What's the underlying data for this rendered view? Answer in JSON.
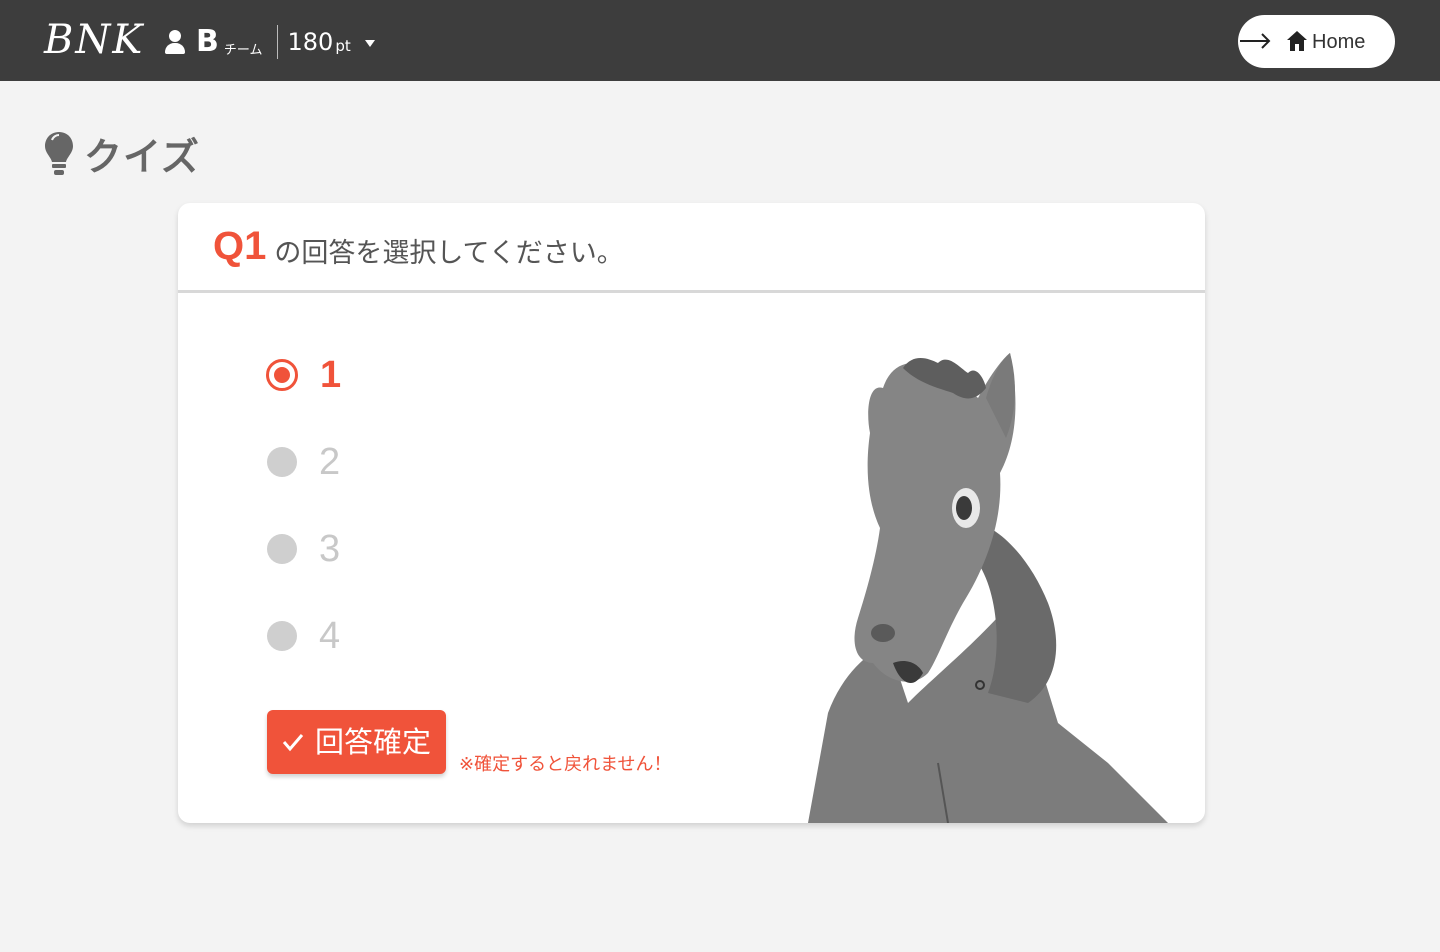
{
  "header": {
    "logo": "BNK",
    "team_name": "B",
    "team_suffix": "チーム",
    "points": "180",
    "points_unit": "pt",
    "home_label": "Home"
  },
  "page": {
    "title": "クイズ"
  },
  "question": {
    "number": "Q1",
    "prompt": "の回答を選択してください。",
    "options": [
      {
        "label": "1",
        "selected": true
      },
      {
        "label": "2",
        "selected": false
      },
      {
        "label": "3",
        "selected": false
      },
      {
        "label": "4",
        "selected": false
      }
    ],
    "confirm_label": "回答確定",
    "warning": "※確定すると戻れません！"
  },
  "colors": {
    "accent": "#f0533a",
    "topbar": "#3d3d3d",
    "background": "#f3f3f3"
  }
}
